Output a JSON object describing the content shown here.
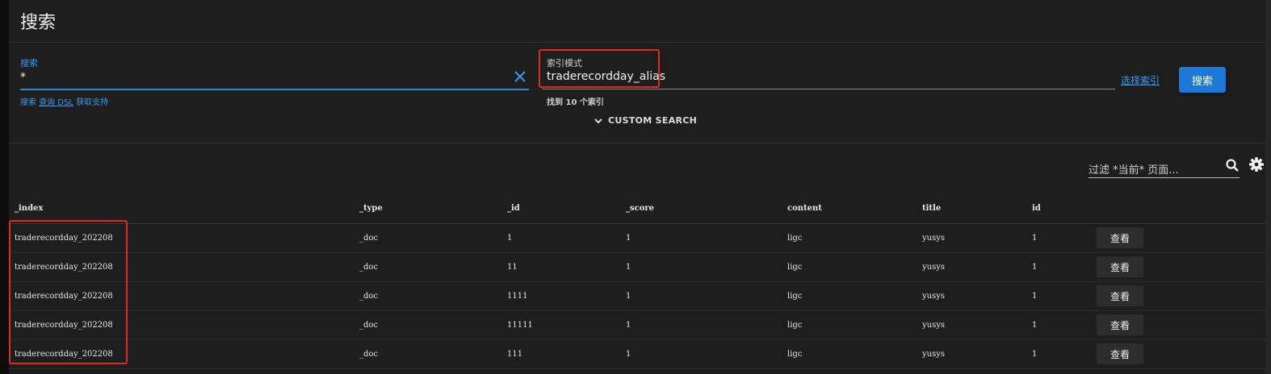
{
  "header": {
    "title": "搜索"
  },
  "search": {
    "label": "搜索",
    "value": "*",
    "links": {
      "search": "搜索",
      "dsl": "查询 DSL",
      "support": "获取支持"
    }
  },
  "index_pattern": {
    "label": "索引模式",
    "value": "traderecordday_alias",
    "found": "找到 10 个索引",
    "choose_link": "选择索引",
    "search_button": "搜索"
  },
  "custom_search": {
    "label": "CUSTOM SEARCH"
  },
  "filter": {
    "placeholder": "过滤 *当前* 页面..."
  },
  "table": {
    "columns": [
      "_index",
      "_type",
      "_id",
      "_score",
      "content",
      "title",
      "id"
    ],
    "view_label": "查看",
    "rows": [
      [
        "traderecordday_202208",
        "_doc",
        "1",
        "1",
        "ligc",
        "yusys",
        "1"
      ],
      [
        "traderecordday_202208",
        "_doc",
        "11",
        "1",
        "ligc",
        "yusys",
        "1"
      ],
      [
        "traderecordday_202208",
        "_doc",
        "1111",
        "1",
        "ligc",
        "yusys",
        "1"
      ],
      [
        "traderecordday_202208",
        "_doc",
        "11111",
        "1",
        "ligc",
        "yusys",
        "1"
      ],
      [
        "traderecordday_202208",
        "_doc",
        "111",
        "1",
        "ligc",
        "yusys",
        "1"
      ]
    ]
  },
  "colors": {
    "accent": "#1e78d8",
    "link": "#3c99f0",
    "highlight": "#e22a1f",
    "background": "#1e1e1e"
  }
}
